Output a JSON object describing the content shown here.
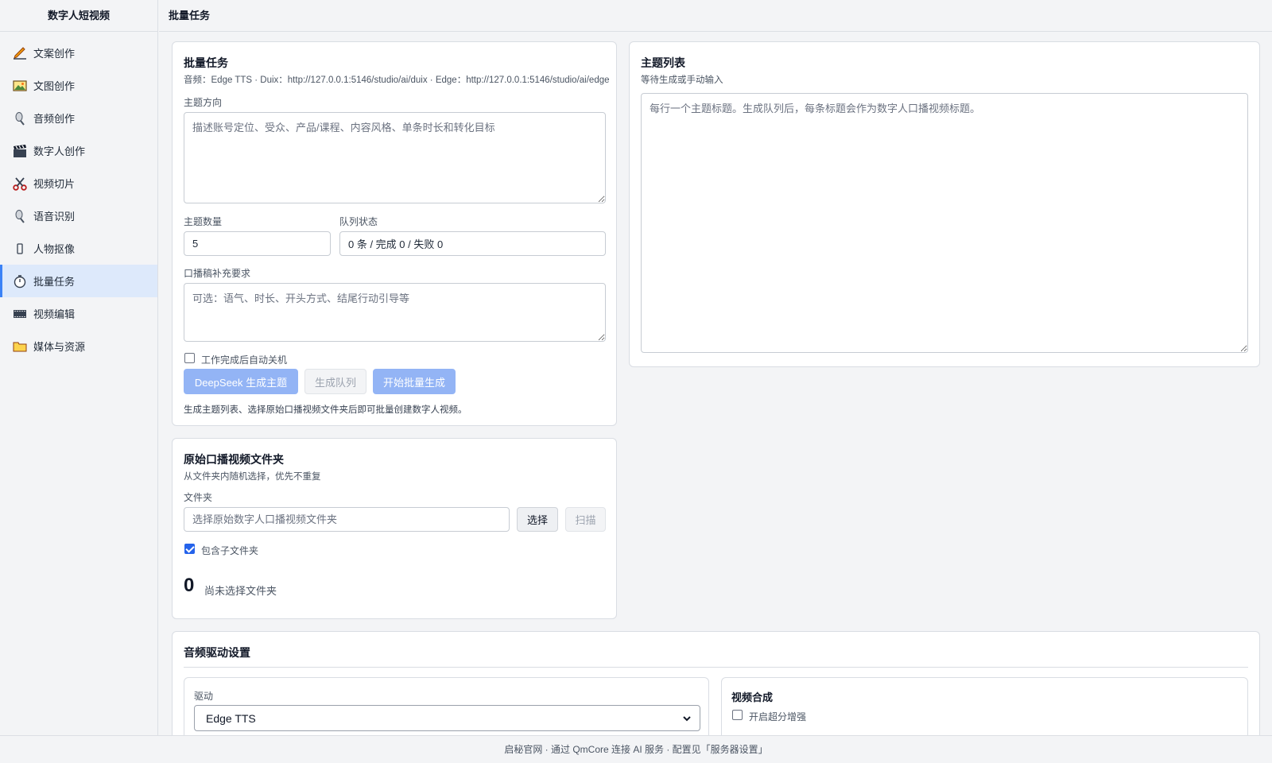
{
  "app": {
    "title": "数字人短视频"
  },
  "header": {
    "title": "批量任务"
  },
  "sidebar": {
    "items": [
      {
        "label": "文案创作",
        "icon": "pencil-icon"
      },
      {
        "label": "文图创作",
        "icon": "picture-icon"
      },
      {
        "label": "音频创作",
        "icon": "microphone-icon"
      },
      {
        "label": "数字人创作",
        "icon": "clapperboard-icon"
      },
      {
        "label": "视频切片",
        "icon": "scissors-icon"
      },
      {
        "label": "语音识别",
        "icon": "microphone-icon"
      },
      {
        "label": "人物抠像",
        "icon": "person-icon"
      },
      {
        "label": "批量任务",
        "icon": "stopwatch-icon",
        "active": true
      },
      {
        "label": "视频编辑",
        "icon": "film-icon"
      },
      {
        "label": "媒体与资源",
        "icon": "folder-icon"
      }
    ]
  },
  "batch": {
    "title": "批量任务",
    "subtitle": "音频：Edge TTS · Duix：http://127.0.0.1:5146/studio/ai/duix · Edge：http://127.0.0.1:5146/studio/ai/edge",
    "topic_label": "主题方向",
    "topic_placeholder": "描述账号定位、受众、产品/课程、内容风格、单条时长和转化目标",
    "count_label": "主题数量",
    "count_value": "5",
    "queue_label": "队列状态",
    "queue_value": "0 条 / 完成 0 / 失败 0",
    "extra_label": "口播稿补充要求",
    "extra_placeholder": "可选：语气、时长、开头方式、结尾行动引导等",
    "shutdown_label": "工作完成后自动关机",
    "shutdown_checked": false,
    "btn_deepseek": "DeepSeek 生成主题",
    "btn_queue": "生成队列",
    "btn_start": "开始批量生成",
    "hint": "生成主题列表、选择原始口播视频文件夹后即可批量创建数字人视频。"
  },
  "topics": {
    "title": "主题列表",
    "subtitle": "等待生成或手动输入",
    "placeholder": "每行一个主题标题。生成队列后，每条标题会作为数字人口播视频标题。"
  },
  "folder": {
    "title": "原始口播视频文件夹",
    "subtitle": "从文件夹内随机选择，优先不重复",
    "label": "文件夹",
    "placeholder": "选择原始数字人口播视频文件夹",
    "btn_select": "选择",
    "btn_scan": "扫描",
    "include_sub_label": "包含子文件夹",
    "include_sub_checked": true,
    "count": "0",
    "status": "尚未选择文件夹"
  },
  "audio": {
    "title": "音频驱动设置",
    "driver_label": "驱动",
    "driver_value": "Edge TTS",
    "compose_title": "视频合成",
    "superres_label": "开启超分增强",
    "superres_checked": false
  },
  "footer": {
    "text": "启秘官网 · 通过 QmCore 连接 AI 服务 · 配置见「服务器设置」"
  },
  "colors": {
    "accent": "#3b82f6",
    "primary_button": "#93b4f5",
    "active_nav": "#dde9fb"
  }
}
